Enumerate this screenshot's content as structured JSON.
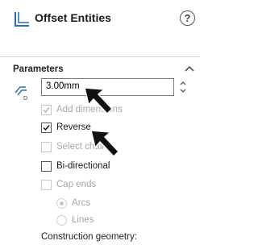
{
  "panel": {
    "title": "Offset Entities",
    "help_label": "?",
    "feature_icon": "offset-entities-icon"
  },
  "toolbar": {
    "ok_icon": "check-icon",
    "cancel_icon": "close-icon",
    "pin_icon": "pushpin-icon"
  },
  "parameters": {
    "title": "Parameters",
    "distance_icon": "offset-distance-icon",
    "distance_value": "3.00mm",
    "add_dimensions": {
      "label": "Add dimensions",
      "checked": true,
      "enabled": false
    },
    "reverse": {
      "label": "Reverse",
      "checked": true,
      "enabled": true
    },
    "select_chain": {
      "label": "Select chain",
      "checked": false,
      "enabled": false
    },
    "bi_directional": {
      "label": "Bi-directional",
      "checked": false,
      "enabled": true
    },
    "cap_ends": {
      "label": "Cap ends",
      "checked": false,
      "enabled": false
    },
    "arcs": {
      "label": "Arcs",
      "selected": true,
      "enabled": false
    },
    "lines": {
      "label": "Lines",
      "selected": false,
      "enabled": false
    },
    "construction_label": "Construction geometry:"
  },
  "colors": {
    "ok_green": "#2aa52a",
    "cancel_red": "#d62020",
    "checkmark_dark": "#1a1a1a",
    "checkmark_disabled": "#b5b5b5"
  }
}
